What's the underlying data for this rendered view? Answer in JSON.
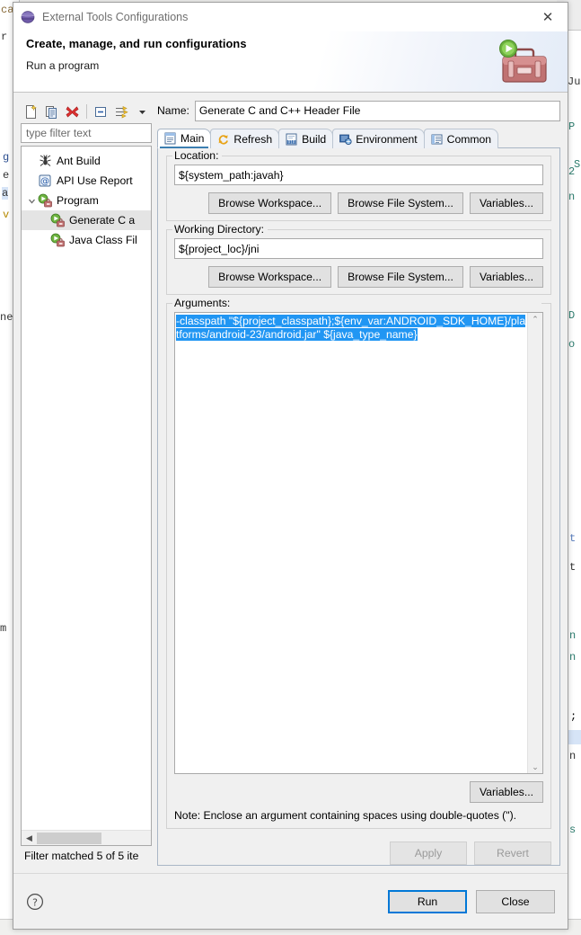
{
  "window": {
    "title": "External Tools Configurations",
    "title_icon": "eclipse-globe-icon",
    "close_label": "✕"
  },
  "banner": {
    "title": "Create, manage, and run configurations",
    "subtitle": "Run a program",
    "art_icon": "toolbox-with-run-badge-icon"
  },
  "toolbar": {
    "buttons": [
      {
        "name": "new-configuration",
        "icon": "new-document-icon"
      },
      {
        "name": "duplicate-configuration",
        "icon": "copy-pages-icon"
      },
      {
        "name": "delete-configuration",
        "icon": "red-x-icon"
      },
      {
        "name": "collapse-all",
        "icon": "collapse-all-icon"
      },
      {
        "name": "filter-configurations",
        "icon": "filter-arrows-icon"
      },
      {
        "name": "view-menu",
        "icon": "chevron-down-icon"
      }
    ]
  },
  "filter": {
    "placeholder": "type filter text",
    "value": "",
    "status": "Filter matched 5 of 5 ite"
  },
  "tree": {
    "items": [
      {
        "label": "Ant Build",
        "icon": "ant-icon",
        "depth": 1,
        "selected": false,
        "expanded": null
      },
      {
        "label": "API Use Report",
        "icon": "api-at-icon",
        "depth": 1,
        "selected": false,
        "expanded": null
      },
      {
        "label": "Program",
        "icon": "program-run-icon",
        "depth": 1,
        "selected": false,
        "expanded": true
      },
      {
        "label": "Generate C a",
        "icon": "program-run-icon",
        "depth": 2,
        "selected": true,
        "expanded": null
      },
      {
        "label": "Java Class Fil",
        "icon": "program-run-icon",
        "depth": 2,
        "selected": false,
        "expanded": null
      }
    ]
  },
  "config": {
    "name_label": "Name:",
    "name_value": "Generate C and C++ Header File",
    "tabs": [
      {
        "label": "Main",
        "icon": "main-sheet-icon",
        "active": true
      },
      {
        "label": "Refresh",
        "icon": "refresh-arrows-icon",
        "active": false
      },
      {
        "label": "Build",
        "icon": "build-binary-icon",
        "active": false
      },
      {
        "label": "Environment",
        "icon": "environment-vars-icon",
        "active": false
      },
      {
        "label": "Common",
        "icon": "common-lines-icon",
        "active": false
      }
    ],
    "location": {
      "label": "Location:",
      "value": "${system_path:javah}",
      "buttons": [
        "Browse Workspace...",
        "Browse File System...",
        "Variables..."
      ]
    },
    "working_directory": {
      "label": "Working Directory:",
      "value": "${project_loc}/jni",
      "buttons": [
        "Browse Workspace...",
        "Browse File System...",
        "Variables..."
      ]
    },
    "arguments": {
      "label": "Arguments:",
      "value_selected": "-classpath \"${project_classpath};${env_var:ANDROID_SDK_HOME}/platforms/android-23/android.jar\" ${java_type_name}",
      "selection_color": "#2196f3",
      "variables_button": "Variables...",
      "note": "Note: Enclose an argument containing spaces using double-quotes (\")."
    },
    "apply_label": "Apply",
    "revert_label": "Revert",
    "apply_enabled": false,
    "revert_enabled": false
  },
  "footer": {
    "help_icon": "help-question-icon",
    "run_label": "Run",
    "close_label": "Close",
    "default_button": "Run"
  },
  "background": {
    "left_fragments": [
      "ca",
      "r",
      "g",
      "e",
      "a",
      "v",
      "ne",
      "m"
    ],
    "right_fragments": [
      "Ju",
      "P",
      "2",
      "n",
      "D",
      "o",
      "t",
      "t",
      "n",
      "n",
      ";",
      "n",
      "s",
      "S"
    ]
  },
  "colors": {
    "accent": "#0078d7",
    "selection": "#2196f3",
    "tree_selection": "#e4e4e4",
    "dialog_bg": "#f0f0f0",
    "tab_active_underline": "#3c7fb1"
  }
}
